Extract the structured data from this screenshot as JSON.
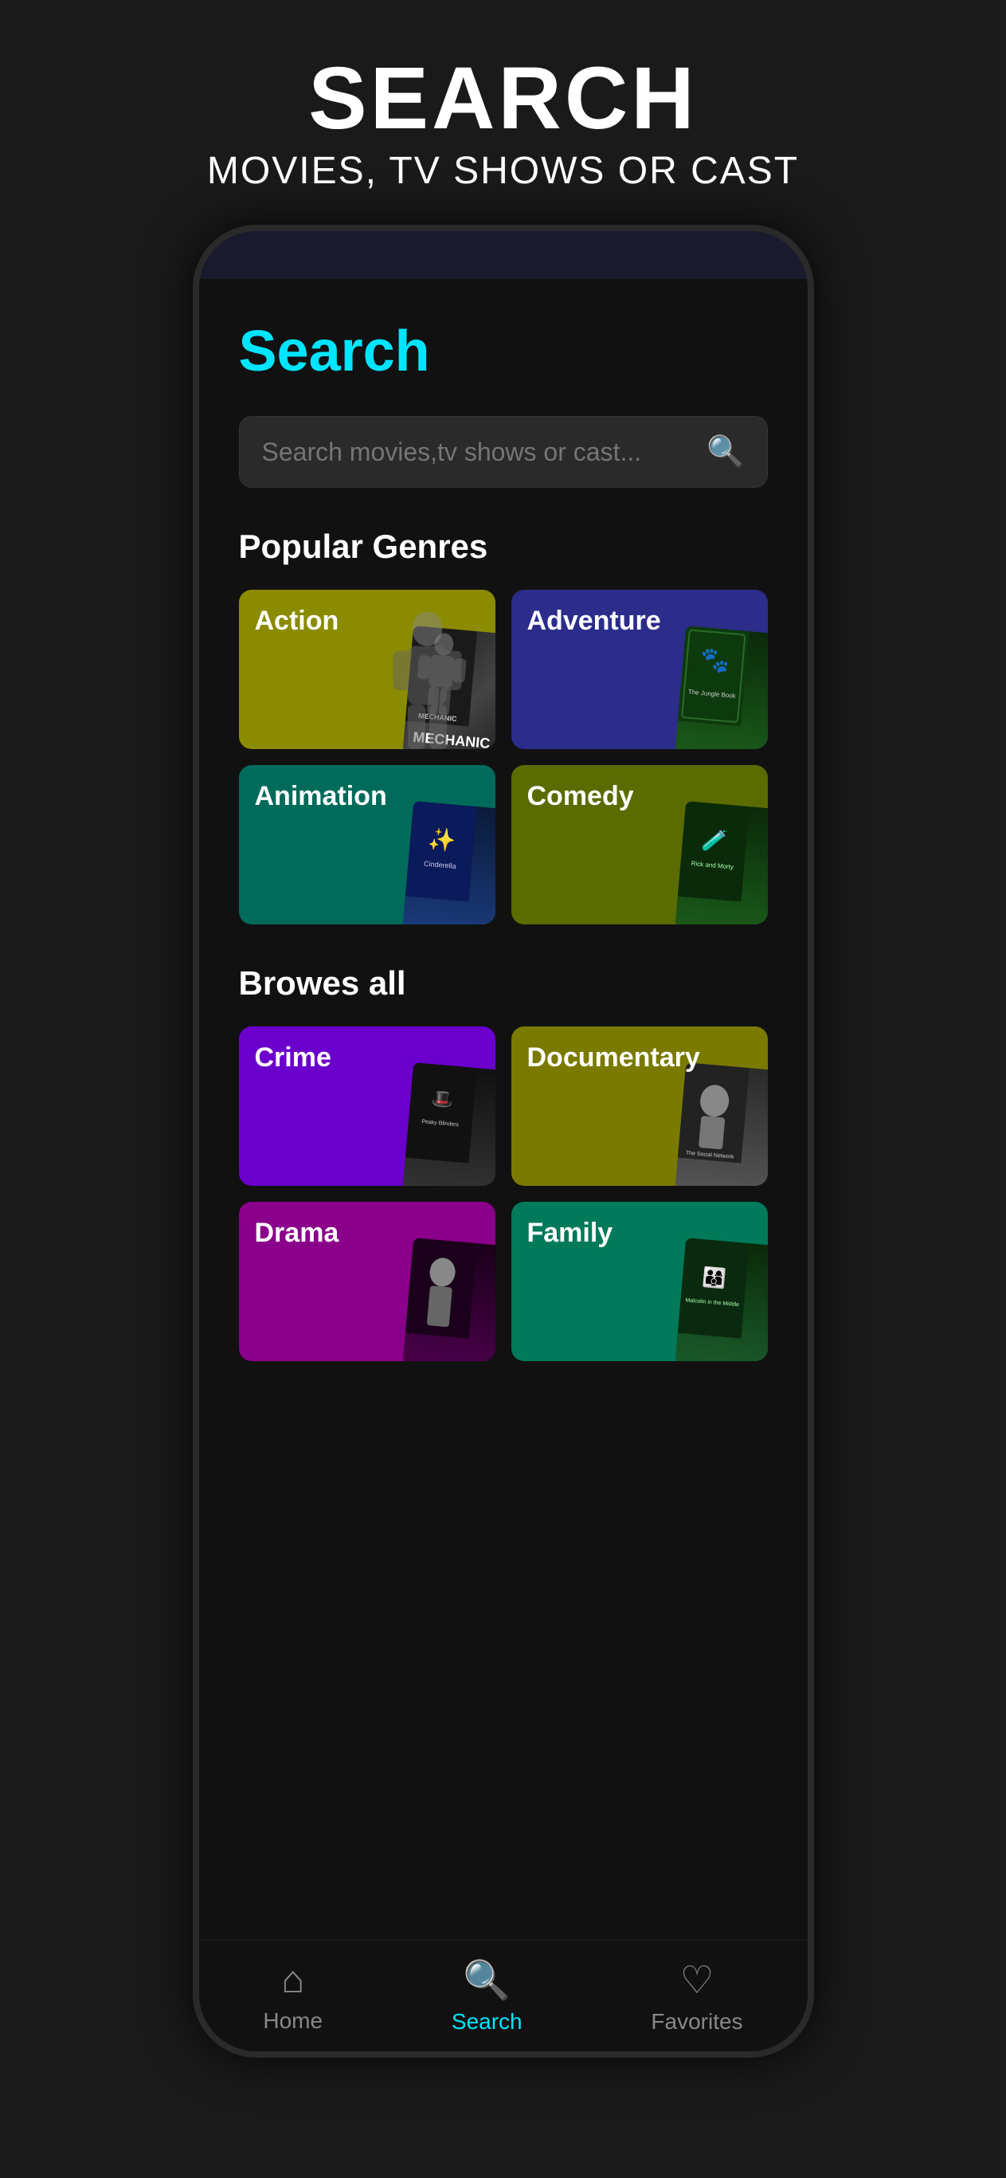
{
  "header": {
    "title": "SEARCH",
    "subtitle": "MOVIES, TV SHOWS OR CAST"
  },
  "page": {
    "title": "Search",
    "search_placeholder": "Search movies,tv shows or cast..."
  },
  "sections": {
    "popular_genres_label": "Popular Genres",
    "browse_all_label": "Browes all"
  },
  "popular_genres": [
    {
      "id": "action",
      "label": "Action",
      "color": "#8b8b00",
      "poster": "mechanic"
    },
    {
      "id": "adventure",
      "label": "Adventure",
      "color": "#2c2c8b",
      "poster": "jungle"
    },
    {
      "id": "animation",
      "label": "Animation",
      "color": "#006b5a",
      "poster": "cinderella"
    },
    {
      "id": "comedy",
      "label": "Comedy",
      "color": "#5a6b00",
      "poster": "rick"
    }
  ],
  "browse_all_genres": [
    {
      "id": "crime",
      "label": "Crime",
      "color": "#6b00cc",
      "poster": "peaky"
    },
    {
      "id": "documentary",
      "label": "Documentary",
      "color": "#7a7a00",
      "poster": "social"
    },
    {
      "id": "drama",
      "label": "Drama",
      "color": "#8b008b",
      "poster": "drama-show"
    },
    {
      "id": "family",
      "label": "Family",
      "color": "#007a5a",
      "poster": "malcolm"
    }
  ],
  "nav": {
    "items": [
      {
        "id": "home",
        "label": "Home",
        "icon": "⌂",
        "active": false
      },
      {
        "id": "search",
        "label": "Search",
        "icon": "⌕",
        "active": true
      },
      {
        "id": "favorites",
        "label": "Favorites",
        "icon": "♡",
        "active": false
      }
    ]
  }
}
